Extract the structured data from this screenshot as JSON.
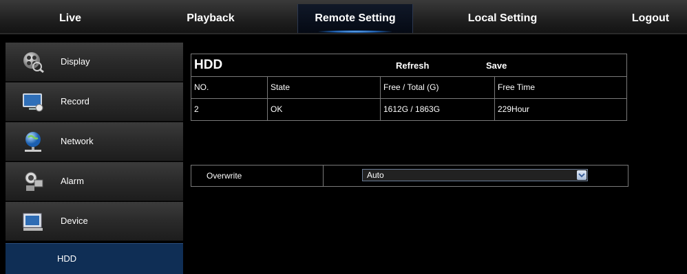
{
  "nav": {
    "tabs": [
      {
        "label": "Live"
      },
      {
        "label": "Playback"
      },
      {
        "label": "Remote Setting",
        "active": true
      },
      {
        "label": "Local Setting"
      },
      {
        "label": "Logout"
      }
    ]
  },
  "sidebar": {
    "items": [
      {
        "label": "Display",
        "icon": "display-icon"
      },
      {
        "label": "Record",
        "icon": "record-icon"
      },
      {
        "label": "Network",
        "icon": "network-globe-icon"
      },
      {
        "label": "Alarm",
        "icon": "alarm-camera-icon"
      },
      {
        "label": "Device",
        "icon": "device-icon"
      }
    ],
    "sub_item": {
      "label": "HDD",
      "selected": true
    }
  },
  "hdd": {
    "title": "HDD",
    "refresh_label": "Refresh",
    "save_label": "Save",
    "columns": [
      "NO.",
      "State",
      "Free / Total (G)",
      "Free Time"
    ],
    "rows": [
      [
        "2",
        "OK",
        "1612G / 1863G",
        "229Hour"
      ]
    ]
  },
  "overwrite": {
    "label": "Overwrite",
    "value": "Auto"
  },
  "colors": {
    "active_tab_glow": "#4f9fff",
    "selected_sub_item": "#0f2e55",
    "border": "#7a7a7a"
  }
}
